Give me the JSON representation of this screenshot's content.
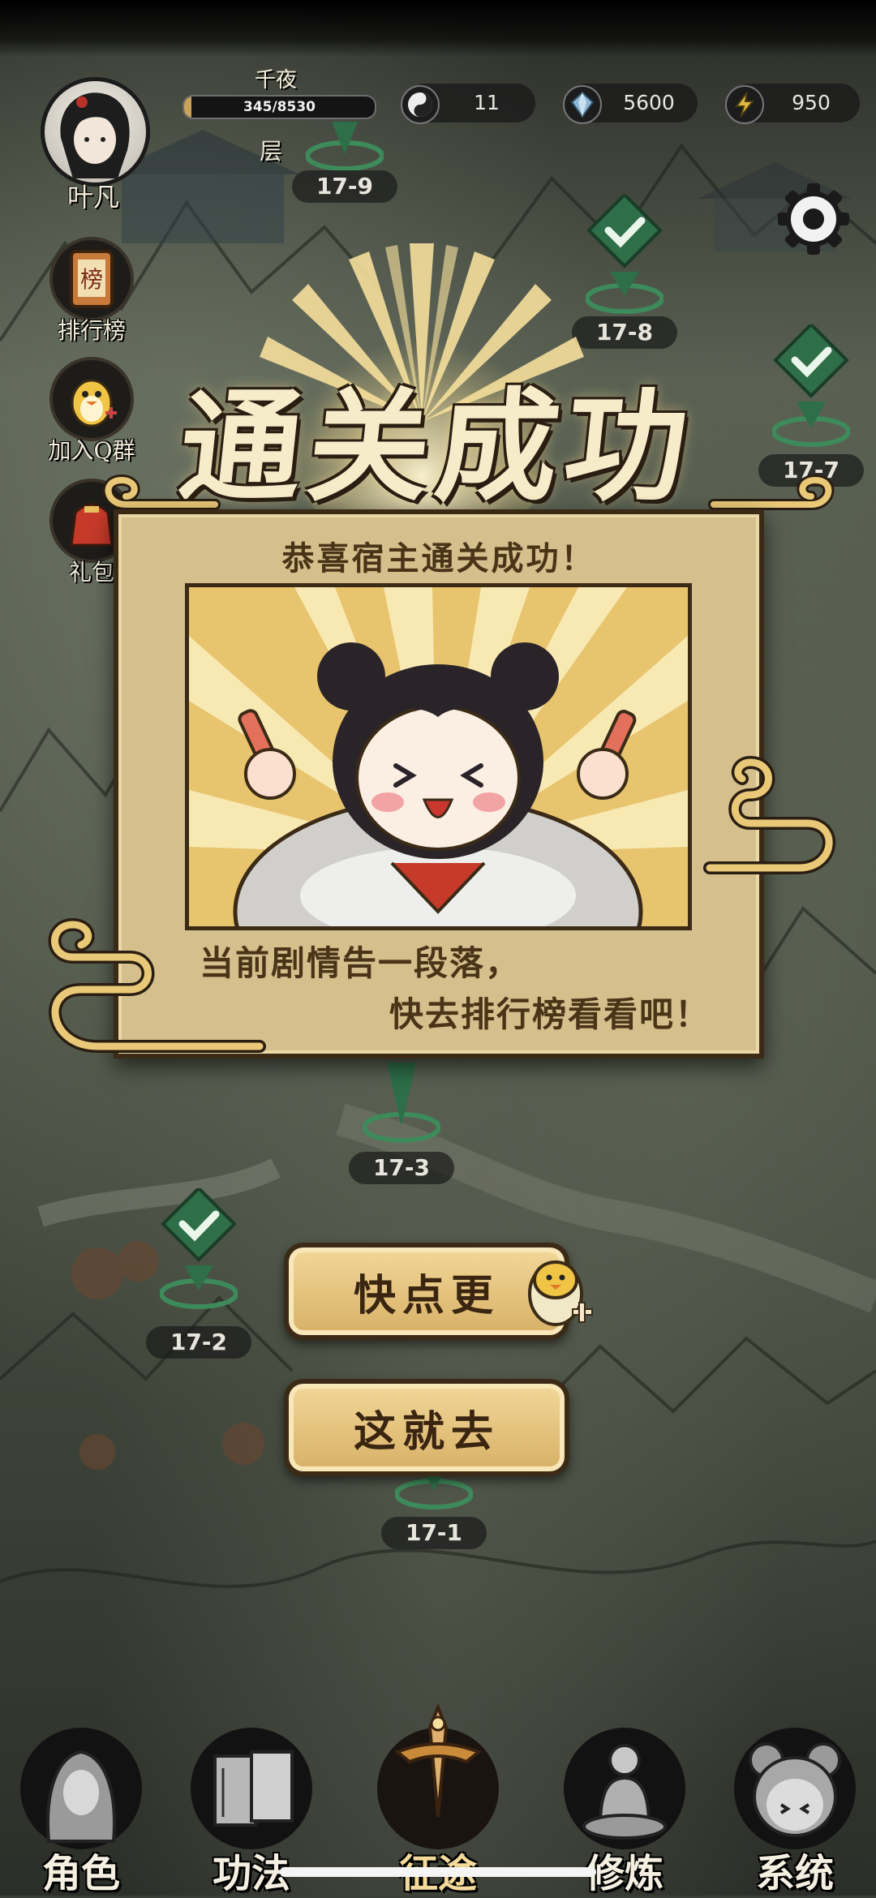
{
  "hud": {
    "player_name": "叶凡",
    "realm_name": "千夜",
    "exp_text": "345/8530",
    "exp_progress": 0.04,
    "layer_text": "层",
    "resources": [
      {
        "icon": "yin-yang-icon",
        "value": "11"
      },
      {
        "icon": "spirit-crystal-icon",
        "value": "5600"
      },
      {
        "icon": "lightning-energy-icon",
        "value": "950"
      }
    ]
  },
  "side_menu": [
    {
      "label": "排行榜",
      "icon": "ranking-scroll-icon",
      "glyph": "榜"
    },
    {
      "label": "加入Q群",
      "icon": "qq-penguin-icon"
    },
    {
      "label": "礼包",
      "icon": "gift-bag-icon"
    }
  ],
  "map_nodes": [
    {
      "label": "17-9",
      "cleared": true
    },
    {
      "label": "17-8",
      "cleared": true
    },
    {
      "label": "17-7",
      "cleared": true
    },
    {
      "label": "17-3",
      "cleared": true
    },
    {
      "label": "17-2",
      "cleared": true
    },
    {
      "label": "17-1",
      "cleared": true
    }
  ],
  "modal": {
    "title": "通关成功",
    "subtitle": "恭喜宿主通关成功！",
    "message_line1": "当前剧情告一段落，",
    "message_line2": "快去排行榜看看吧！",
    "button_more": "快点更",
    "button_go": "这就去"
  },
  "bottom_nav": [
    {
      "label": "角色",
      "icon": "hooded-character-icon",
      "active": false
    },
    {
      "label": "功法",
      "icon": "scripture-books-icon",
      "active": false
    },
    {
      "label": "征途",
      "icon": "sword-emblem-icon",
      "active": true
    },
    {
      "label": "修炼",
      "icon": "meditation-icon",
      "active": false
    },
    {
      "label": "系统",
      "icon": "system-girl-icon",
      "active": false
    }
  ],
  "colors": {
    "accent_gold": "#d8b066",
    "panel": "#d4bf8d",
    "ink": "#3a2a16",
    "node_green": "#2e6e48"
  }
}
